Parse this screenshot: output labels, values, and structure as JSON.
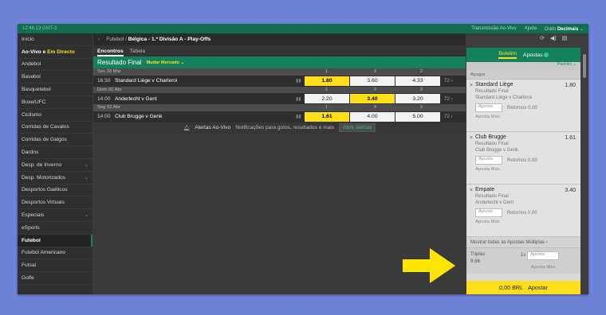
{
  "topbar": {
    "clock": "12:46:13 GMT-3",
    "links": [
      "Transmissão Ao-Vivo",
      "Ajuda"
    ],
    "odds_label": "Odds",
    "odds_value": "Decimais"
  },
  "sidebar": {
    "items": [
      {
        "label": "Início"
      },
      {
        "label_a": "Ao-Vivo e ",
        "label_b": "Em Directo"
      },
      {
        "label": "Andebol"
      },
      {
        "label": "Basebol"
      },
      {
        "label": "Basquetebol"
      },
      {
        "label": "Boxe/UFC"
      },
      {
        "label": "Ciclismo"
      },
      {
        "label": "Corridas de Cavalos"
      },
      {
        "label": "Corridas de Galgos"
      },
      {
        "label": "Dardos"
      },
      {
        "label": "Desp. de Inverno"
      },
      {
        "label": "Desp. Motorizados"
      },
      {
        "label": "Desportos Gaélicos"
      },
      {
        "label": "Desportos Virtuais"
      },
      {
        "label": "Especiais"
      },
      {
        "label": "eSports"
      },
      {
        "label": "Futebol"
      },
      {
        "label": "Futebol Americano"
      },
      {
        "label": "Futsal"
      },
      {
        "label": "Golfe"
      }
    ]
  },
  "breadcrumb": {
    "root": "Futebol",
    "sep": "/",
    "league": "Bélgica - 1.ª Divisão A - Play-Offs"
  },
  "tabs": [
    "Encontros",
    "Tabela"
  ],
  "market": {
    "title": "Resultado Final",
    "change": "Mudar Mercado"
  },
  "col_headers": [
    "1",
    "X",
    "2"
  ],
  "matches": [
    {
      "date": "Sex 30 Mar",
      "time": "16:30",
      "teams": "Standard Liège v Charleroi",
      "odds": [
        "1.80",
        "3.60",
        "4.33"
      ],
      "more": "72"
    },
    {
      "date": "Dom 01 Abr",
      "time": "14:00",
      "teams": "Anderlecht v Gent",
      "odds": [
        "2.20",
        "3.40",
        "3.20"
      ],
      "more": "72"
    },
    {
      "date": "Seg 02 Abr",
      "time": "14:00",
      "teams": "Club Brugge v Genk",
      "odds": [
        "1.61",
        "4.00",
        "5.00"
      ],
      "more": "72"
    }
  ],
  "alerts": {
    "title": "Alertas Ao-Vivo",
    "text": "Notificações para golos, resultados e mais",
    "button": "Abrir Alertas"
  },
  "betslip": {
    "tabs": [
      "Boletim",
      "Apostas"
    ],
    "mode": "Padrão",
    "clear": "Apagar",
    "selections": [
      {
        "name": "Standard Liège",
        "price": "1.80",
        "market": "Resultado Final",
        "event": "Standard Liège v Charleroi",
        "stake_placeholder": "Aposta",
        "returns": "Retornos 0,00",
        "max": "Aposta Máx."
      },
      {
        "name": "Club Brugge",
        "price": "1.61",
        "market": "Resultado Final",
        "event": "Club Brugge v Genk",
        "stake_placeholder": "Aposta",
        "returns": "Retornos 0,00",
        "max": "Aposta Máx."
      },
      {
        "name": "Empate",
        "price": "3.40",
        "market": "Resultado Final",
        "event": "Anderlecht v Gent",
        "stake_placeholder": "Aposta",
        "returns": "Retornos 0,00",
        "max": "Aposta Máx."
      }
    ],
    "show_multiples": "Mostrar todas as Apostas Múltiplas",
    "triplas": {
      "label": "Triplas",
      "odds": "9.86",
      "mult": "1x",
      "stake_placeholder": "Aposta",
      "max": "Aposta Máx."
    },
    "place": {
      "amount": "0,00 BRL",
      "label": "Apostar"
    }
  },
  "colors": {
    "header_green": "#14805e",
    "odds_yellow": "#ffdf1b",
    "page_bg": "#6f83d6"
  }
}
